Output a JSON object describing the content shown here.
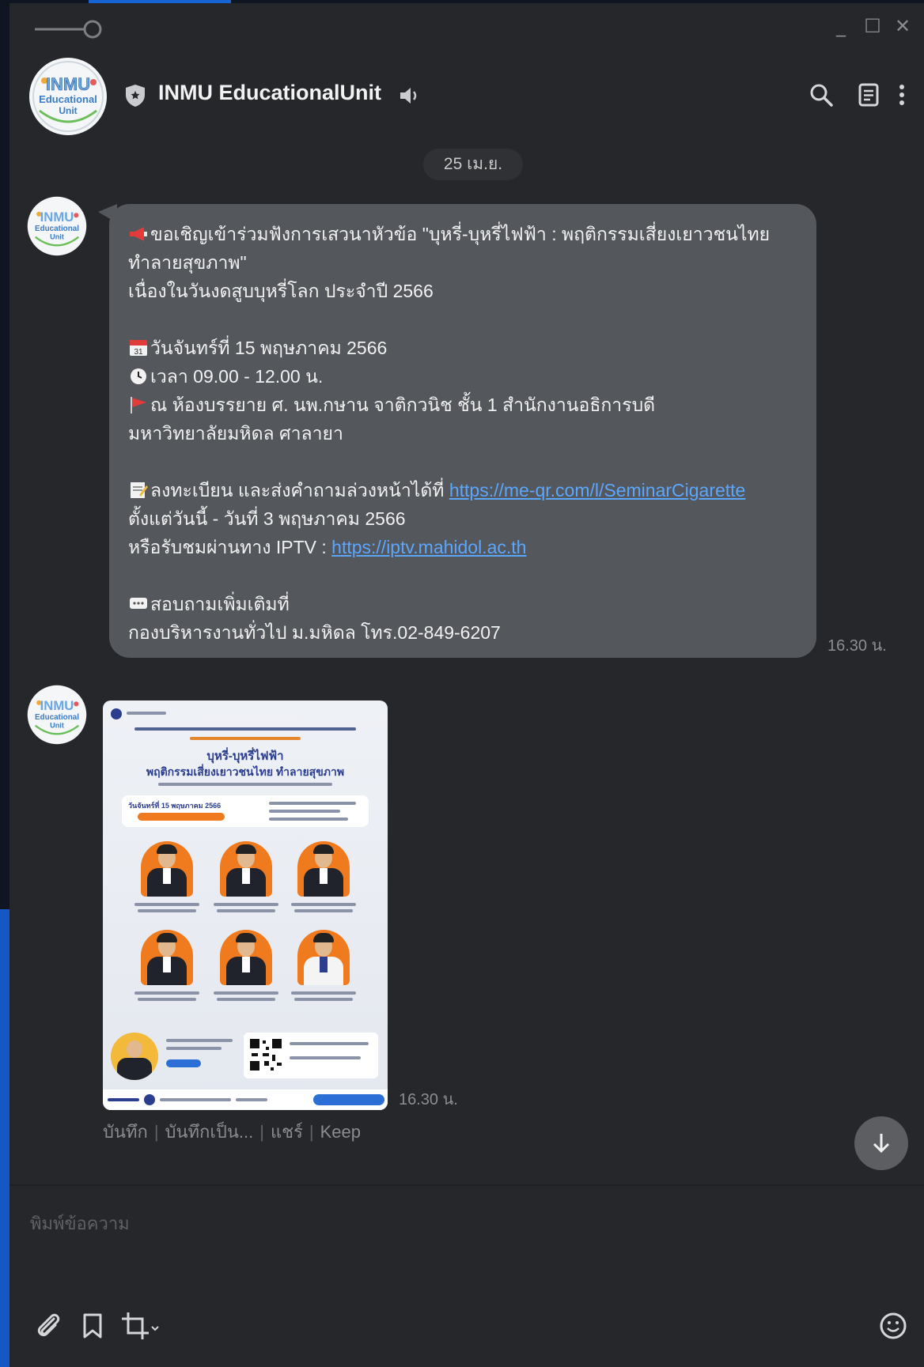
{
  "window": {
    "controls": {
      "minimize": "_",
      "maximize": "☐",
      "close": "✕"
    }
  },
  "header": {
    "avatar_text": [
      "INMU",
      "Educational",
      "Unit"
    ],
    "title": "INMU EducationalUnit"
  },
  "chat": {
    "date": "25 เม.ย.",
    "message1": {
      "lines": [
        "ขอเชิญเข้าร่วมฟังการเสวนาหัวข้อ \"บุหรี่-บุหรี่ไฟฟ้า : พฤติกรรมเสี่ยงเยาวชนไทย",
        "ทำลายสุขภาพ\"",
        "เนื่องในวันงดสูบบุหรี่โลก ประจำปี 2566",
        "วันจันทร์ที่ 15 พฤษภาคม 2566",
        "เวลา 09.00 - 12.00 น.",
        "ณ ห้องบรรยาย ศ. นพ.กษาน จาติกวนิช ชั้น 1 สำนักงานอธิการบดี",
        "มหาวิทยาลัยมหิดล ศาลายา",
        "ลงทะเบียน และส่งคำถามล่วงหน้าได้ที่ ",
        "https://me-qr.com/l/SeminarCigarette",
        "ตั้งแต่วันนี้ - วันที่ 3 พฤษภาคม 2566",
        "หรือรับชมผ่านทาง IPTV : ",
        "https://iptv.mahidol.ac.th",
        "สอบถามเพิ่มเติมที่",
        "กองบริหารงานทั่วไป ม.มหิดล โทร.02-849-6207"
      ],
      "time": "16.30 น."
    },
    "message2": {
      "poster_title1": "บุหรี่-บุหรี่ไฟฟ้า",
      "poster_title2": "พฤติกรรมเสี่ยงเยาวชนไทย ทำลายสุขภาพ",
      "poster_date": "วันจันทร์ที่ 15 พฤษภาคม 2566",
      "time": "16.30 น.",
      "actions": [
        "บันทึก",
        "บันทึกเป็น...",
        "แชร์",
        "Keep"
      ]
    }
  },
  "composer": {
    "placeholder": "พิมพ์ข้อความ"
  },
  "colors": {
    "window_bg": "#25272b",
    "bubble_bg": "#54575c",
    "link": "#5ba7ff",
    "muted_text": "#8a8c90"
  }
}
